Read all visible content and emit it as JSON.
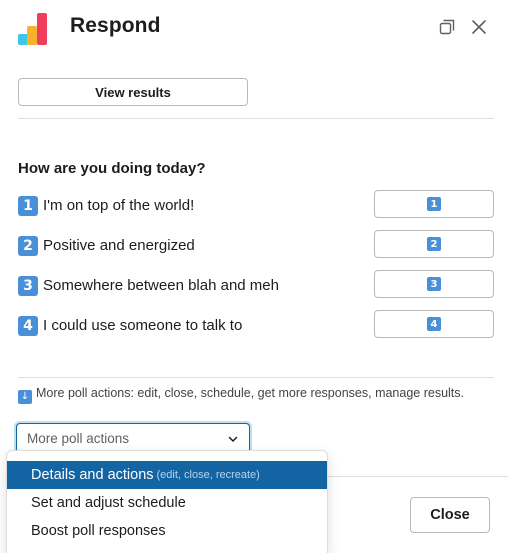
{
  "header": {
    "title": "Respond",
    "logo_colors": [
      "#3ec5ea",
      "#f7b12d",
      "#ef3d5c"
    ],
    "expand_icon": "expand-window-icon",
    "close_icon": "close-icon"
  },
  "view_results_label": "View results",
  "poll": {
    "question": "How are you doing today?",
    "options": [
      {
        "emoji": "1",
        "label": "I'm on top of the world!",
        "vote_emoji": "1"
      },
      {
        "emoji": "2",
        "label": "Positive and energized",
        "vote_emoji": "2"
      },
      {
        "emoji": "3",
        "label": "Somewhere between blah and meh",
        "vote_emoji": "3"
      },
      {
        "emoji": "4",
        "label": "I could use someone to talk to",
        "vote_emoji": "4"
      }
    ]
  },
  "more_hint": {
    "arrow": "↓",
    "text": "More poll actions: edit, close, schedule, get more responses, manage results."
  },
  "select": {
    "placeholder": "More poll actions"
  },
  "dropdown": {
    "items": [
      {
        "label": "Details and actions",
        "desc": "(edit, close, recreate)"
      },
      {
        "label": "Set and adjust schedule",
        "desc": ""
      },
      {
        "label": "Boost poll responses",
        "desc": ""
      }
    ]
  },
  "footer": {
    "close_label": "Close"
  },
  "colors": {
    "accent": "#1264a3",
    "emoji_key": "#4a90d9"
  }
}
